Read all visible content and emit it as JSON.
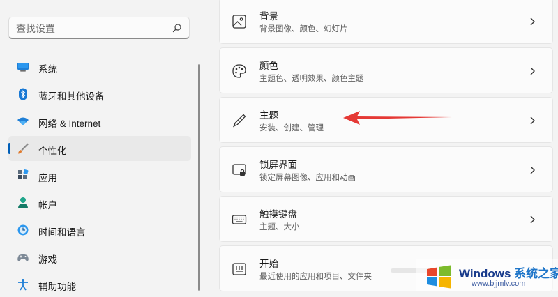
{
  "search": {
    "placeholder": "查找设置"
  },
  "sidebar": {
    "items": [
      {
        "label": "系统",
        "icon": "system-display-icon",
        "active": false
      },
      {
        "label": "蓝牙和其他设备",
        "icon": "bluetooth-icon",
        "active": false
      },
      {
        "label": "网络 & Internet",
        "icon": "wifi-icon",
        "active": false
      },
      {
        "label": "个性化",
        "icon": "brush-icon",
        "active": true
      },
      {
        "label": "应用",
        "icon": "apps-icon",
        "active": false
      },
      {
        "label": "帐户",
        "icon": "person-icon",
        "active": false
      },
      {
        "label": "时间和语言",
        "icon": "clock-globe-icon",
        "active": false
      },
      {
        "label": "游戏",
        "icon": "gamepad-icon",
        "active": false
      },
      {
        "label": "辅助功能",
        "icon": "accessibility-icon",
        "active": false
      }
    ]
  },
  "cards": [
    {
      "title": "背景",
      "subtitle": "背景图像、颜色、幻灯片",
      "icon": "picture-icon"
    },
    {
      "title": "颜色",
      "subtitle": "主题色、透明效果、颜色主题",
      "icon": "palette-icon"
    },
    {
      "title": "主题",
      "subtitle": "安装、创建、管理",
      "icon": "pen-icon"
    },
    {
      "title": "锁屏界面",
      "subtitle": "锁定屏幕图像、应用和动画",
      "icon": "lock-screen-icon"
    },
    {
      "title": "触摸键盘",
      "subtitle": "主题、大小",
      "icon": "keyboard-icon"
    },
    {
      "title": "开始",
      "subtitle": "最近使用的应用和项目、文件夹",
      "icon": "start-menu-icon"
    }
  ],
  "watermark": {
    "brand": "Windows",
    "brand_cn": "系统之家",
    "url": "www.bjjmlv.com"
  },
  "colors": {
    "accent": "#005fb8",
    "arrow": "#e53935",
    "background": "#f3f3f3",
    "card": "#fbfbfb"
  }
}
